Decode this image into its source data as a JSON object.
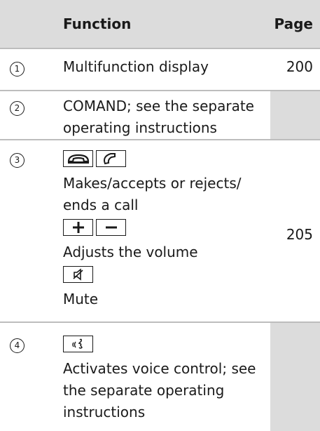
{
  "header": {
    "col_function": "Function",
    "col_page": "Page"
  },
  "rows": [
    {
      "num": "1",
      "text": "Multifunction display",
      "page": "200"
    },
    {
      "num": "2",
      "text_l1": "COMAND; see the separate",
      "text_l2": "operating instructions",
      "page": ""
    },
    {
      "num": "3",
      "call_text_l1": "Makes/accepts or rejects/",
      "call_text_l2": "ends a call",
      "volume_text": "Adjusts the volume",
      "mute_text": "Mute",
      "page": "205",
      "icons": [
        "hang-up-phone-icon",
        "accept-call-phone-icon",
        "plus-key-icon",
        "minus-key-icon",
        "mute-speaker-icon"
      ]
    },
    {
      "num": "4",
      "text_l1": "Activates voice control; see",
      "text_l2": "the separate operating",
      "text_l3": "instructions",
      "page": "",
      "icons": [
        "voice-control-icon"
      ]
    }
  ],
  "colors": {
    "header_bg": "#dcdcdc",
    "row_alt_bg": "#dcdcdc",
    "text": "#1a1a1a"
  }
}
